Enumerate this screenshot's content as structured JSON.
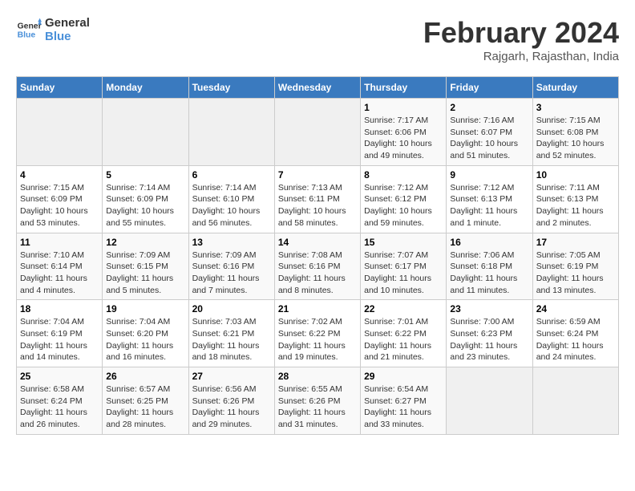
{
  "logo": {
    "line1": "General",
    "line2": "Blue"
  },
  "title": "February 2024",
  "subtitle": "Rajgarh, Rajasthan, India",
  "weekdays": [
    "Sunday",
    "Monday",
    "Tuesday",
    "Wednesday",
    "Thursday",
    "Friday",
    "Saturday"
  ],
  "weeks": [
    [
      {
        "day": "",
        "sunrise": "",
        "sunset": "",
        "daylight": ""
      },
      {
        "day": "",
        "sunrise": "",
        "sunset": "",
        "daylight": ""
      },
      {
        "day": "",
        "sunrise": "",
        "sunset": "",
        "daylight": ""
      },
      {
        "day": "",
        "sunrise": "",
        "sunset": "",
        "daylight": ""
      },
      {
        "day": "1",
        "sunrise": "Sunrise: 7:17 AM",
        "sunset": "Sunset: 6:06 PM",
        "daylight": "Daylight: 10 hours and 49 minutes."
      },
      {
        "day": "2",
        "sunrise": "Sunrise: 7:16 AM",
        "sunset": "Sunset: 6:07 PM",
        "daylight": "Daylight: 10 hours and 51 minutes."
      },
      {
        "day": "3",
        "sunrise": "Sunrise: 7:15 AM",
        "sunset": "Sunset: 6:08 PM",
        "daylight": "Daylight: 10 hours and 52 minutes."
      }
    ],
    [
      {
        "day": "4",
        "sunrise": "Sunrise: 7:15 AM",
        "sunset": "Sunset: 6:09 PM",
        "daylight": "Daylight: 10 hours and 53 minutes."
      },
      {
        "day": "5",
        "sunrise": "Sunrise: 7:14 AM",
        "sunset": "Sunset: 6:09 PM",
        "daylight": "Daylight: 10 hours and 55 minutes."
      },
      {
        "day": "6",
        "sunrise": "Sunrise: 7:14 AM",
        "sunset": "Sunset: 6:10 PM",
        "daylight": "Daylight: 10 hours and 56 minutes."
      },
      {
        "day": "7",
        "sunrise": "Sunrise: 7:13 AM",
        "sunset": "Sunset: 6:11 PM",
        "daylight": "Daylight: 10 hours and 58 minutes."
      },
      {
        "day": "8",
        "sunrise": "Sunrise: 7:12 AM",
        "sunset": "Sunset: 6:12 PM",
        "daylight": "Daylight: 10 hours and 59 minutes."
      },
      {
        "day": "9",
        "sunrise": "Sunrise: 7:12 AM",
        "sunset": "Sunset: 6:13 PM",
        "daylight": "Daylight: 11 hours and 1 minute."
      },
      {
        "day": "10",
        "sunrise": "Sunrise: 7:11 AM",
        "sunset": "Sunset: 6:13 PM",
        "daylight": "Daylight: 11 hours and 2 minutes."
      }
    ],
    [
      {
        "day": "11",
        "sunrise": "Sunrise: 7:10 AM",
        "sunset": "Sunset: 6:14 PM",
        "daylight": "Daylight: 11 hours and 4 minutes."
      },
      {
        "day": "12",
        "sunrise": "Sunrise: 7:09 AM",
        "sunset": "Sunset: 6:15 PM",
        "daylight": "Daylight: 11 hours and 5 minutes."
      },
      {
        "day": "13",
        "sunrise": "Sunrise: 7:09 AM",
        "sunset": "Sunset: 6:16 PM",
        "daylight": "Daylight: 11 hours and 7 minutes."
      },
      {
        "day": "14",
        "sunrise": "Sunrise: 7:08 AM",
        "sunset": "Sunset: 6:16 PM",
        "daylight": "Daylight: 11 hours and 8 minutes."
      },
      {
        "day": "15",
        "sunrise": "Sunrise: 7:07 AM",
        "sunset": "Sunset: 6:17 PM",
        "daylight": "Daylight: 11 hours and 10 minutes."
      },
      {
        "day": "16",
        "sunrise": "Sunrise: 7:06 AM",
        "sunset": "Sunset: 6:18 PM",
        "daylight": "Daylight: 11 hours and 11 minutes."
      },
      {
        "day": "17",
        "sunrise": "Sunrise: 7:05 AM",
        "sunset": "Sunset: 6:19 PM",
        "daylight": "Daylight: 11 hours and 13 minutes."
      }
    ],
    [
      {
        "day": "18",
        "sunrise": "Sunrise: 7:04 AM",
        "sunset": "Sunset: 6:19 PM",
        "daylight": "Daylight: 11 hours and 14 minutes."
      },
      {
        "day": "19",
        "sunrise": "Sunrise: 7:04 AM",
        "sunset": "Sunset: 6:20 PM",
        "daylight": "Daylight: 11 hours and 16 minutes."
      },
      {
        "day": "20",
        "sunrise": "Sunrise: 7:03 AM",
        "sunset": "Sunset: 6:21 PM",
        "daylight": "Daylight: 11 hours and 18 minutes."
      },
      {
        "day": "21",
        "sunrise": "Sunrise: 7:02 AM",
        "sunset": "Sunset: 6:22 PM",
        "daylight": "Daylight: 11 hours and 19 minutes."
      },
      {
        "day": "22",
        "sunrise": "Sunrise: 7:01 AM",
        "sunset": "Sunset: 6:22 PM",
        "daylight": "Daylight: 11 hours and 21 minutes."
      },
      {
        "day": "23",
        "sunrise": "Sunrise: 7:00 AM",
        "sunset": "Sunset: 6:23 PM",
        "daylight": "Daylight: 11 hours and 23 minutes."
      },
      {
        "day": "24",
        "sunrise": "Sunrise: 6:59 AM",
        "sunset": "Sunset: 6:24 PM",
        "daylight": "Daylight: 11 hours and 24 minutes."
      }
    ],
    [
      {
        "day": "25",
        "sunrise": "Sunrise: 6:58 AM",
        "sunset": "Sunset: 6:24 PM",
        "daylight": "Daylight: 11 hours and 26 minutes."
      },
      {
        "day": "26",
        "sunrise": "Sunrise: 6:57 AM",
        "sunset": "Sunset: 6:25 PM",
        "daylight": "Daylight: 11 hours and 28 minutes."
      },
      {
        "day": "27",
        "sunrise": "Sunrise: 6:56 AM",
        "sunset": "Sunset: 6:26 PM",
        "daylight": "Daylight: 11 hours and 29 minutes."
      },
      {
        "day": "28",
        "sunrise": "Sunrise: 6:55 AM",
        "sunset": "Sunset: 6:26 PM",
        "daylight": "Daylight: 11 hours and 31 minutes."
      },
      {
        "day": "29",
        "sunrise": "Sunrise: 6:54 AM",
        "sunset": "Sunset: 6:27 PM",
        "daylight": "Daylight: 11 hours and 33 minutes."
      },
      {
        "day": "",
        "sunrise": "",
        "sunset": "",
        "daylight": ""
      },
      {
        "day": "",
        "sunrise": "",
        "sunset": "",
        "daylight": ""
      }
    ]
  ]
}
